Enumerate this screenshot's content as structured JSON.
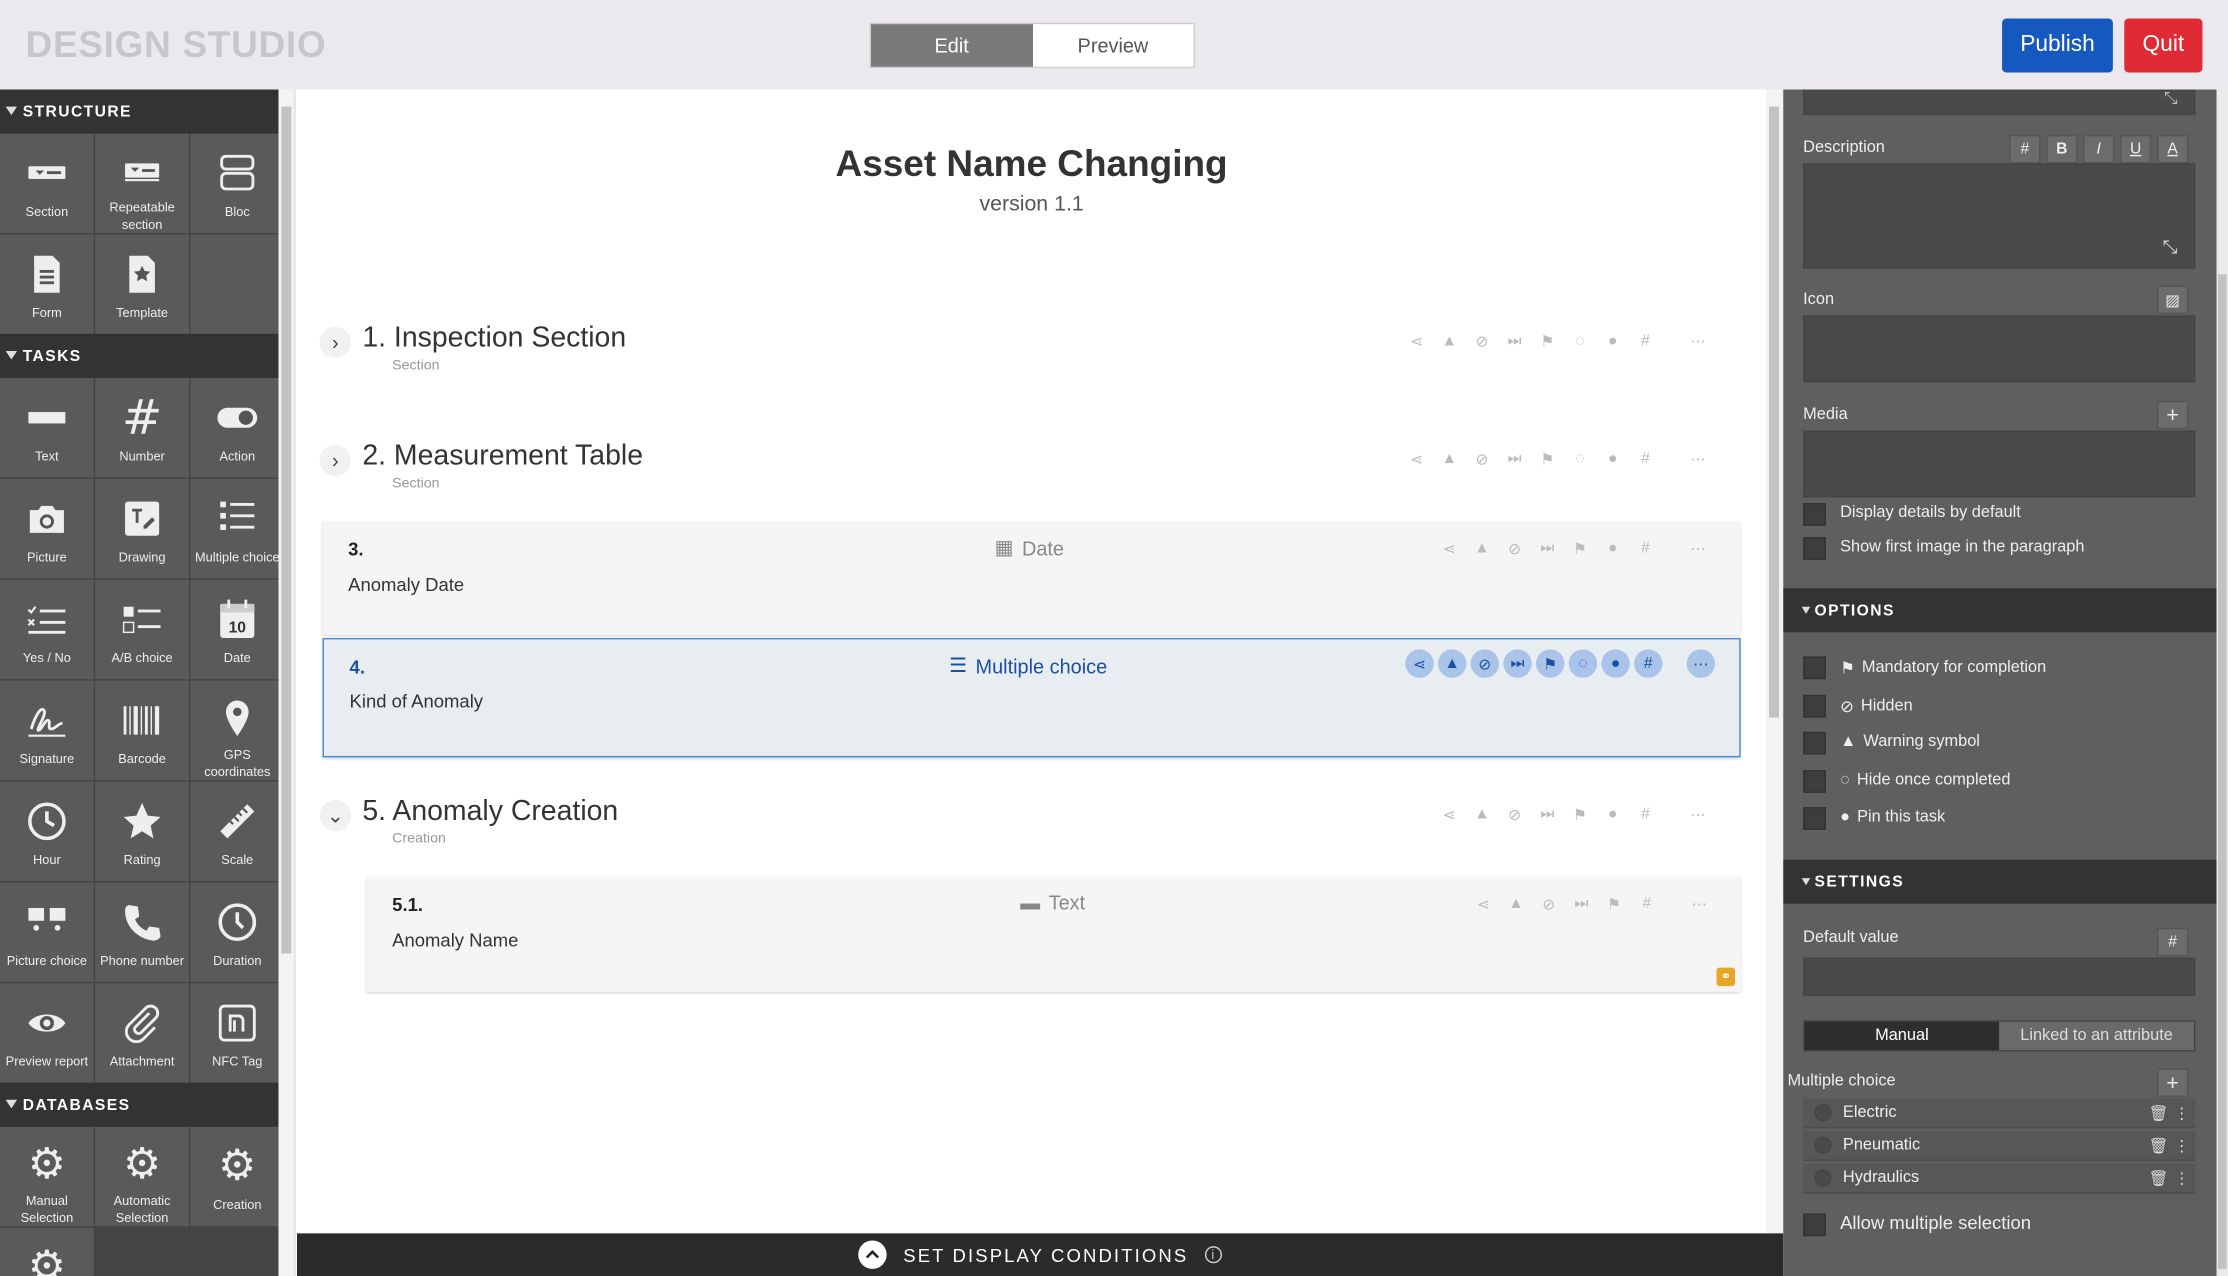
{
  "app": {
    "brand": "DESIGN STUDIO"
  },
  "mode_toggle": {
    "edit": "Edit",
    "preview": "Preview",
    "active": "Edit"
  },
  "actions": {
    "publish": "Publish",
    "quit": "Quit"
  },
  "colors": {
    "publish": "#1558c0",
    "quit": "#e02a35",
    "selected_accent": "#1d4fa3"
  },
  "palette": {
    "structure": {
      "title": "STRUCTURE",
      "items": [
        {
          "label": "Section",
          "icon": "section-icon"
        },
        {
          "label": "Repeatable section",
          "icon": "repeatable-section-icon"
        },
        {
          "label": "Bloc",
          "icon": "bloc-icon"
        },
        {
          "label": "Form",
          "icon": "form-icon"
        },
        {
          "label": "Template",
          "icon": "template-icon"
        }
      ]
    },
    "tasks": {
      "title": "TASKS",
      "items": [
        {
          "label": "Text",
          "icon": "text-field-icon"
        },
        {
          "label": "Number",
          "icon": "hash-icon"
        },
        {
          "label": "Action",
          "icon": "toggle-icon"
        },
        {
          "label": "Picture",
          "icon": "camera-icon"
        },
        {
          "label": "Drawing",
          "icon": "drawing-icon"
        },
        {
          "label": "Multiple choice",
          "icon": "list-icon"
        },
        {
          "label": "Yes / No",
          "icon": "yes-no-icon"
        },
        {
          "label": "A/B choice",
          "icon": "ab-choice-icon"
        },
        {
          "label": "Date",
          "icon": "calendar-icon"
        },
        {
          "label": "Signature",
          "icon": "signature-icon"
        },
        {
          "label": "Barcode",
          "icon": "barcode-icon"
        },
        {
          "label": "GPS coordinates",
          "icon": "location-pin-icon"
        },
        {
          "label": "Hour",
          "icon": "clock-icon"
        },
        {
          "label": "Rating",
          "icon": "star-icon"
        },
        {
          "label": "Scale",
          "icon": "ruler-icon"
        },
        {
          "label": "Picture choice",
          "icon": "picture-choice-icon"
        },
        {
          "label": "Phone number",
          "icon": "phone-icon"
        },
        {
          "label": "Duration",
          "icon": "duration-icon"
        },
        {
          "label": "Preview report",
          "icon": "eye-icon"
        },
        {
          "label": "Attachment",
          "icon": "paperclip-icon"
        },
        {
          "label": "NFC Tag",
          "icon": "nfc-icon"
        }
      ]
    },
    "databases": {
      "title": "DATABASES",
      "items": [
        {
          "label": "Manual Selection",
          "icon": "gear-icon"
        },
        {
          "label": "Automatic Selection",
          "icon": "gear-icon"
        },
        {
          "label": "Creation",
          "icon": "gear-icon"
        }
      ]
    }
  },
  "form": {
    "title": "Asset Name Changing",
    "version": "version 1.1",
    "sections": [
      {
        "label": "1. Inspection Section",
        "type": "Section"
      },
      {
        "label": "2. Measurement Table",
        "type": "Section"
      },
      {
        "label": "5. Anomaly Creation",
        "type": "Creation"
      }
    ],
    "tasks": [
      {
        "num": "3.",
        "type": "Date",
        "name": "Anomaly Date"
      },
      {
        "num": "4.",
        "type": "Multiple choice",
        "name": "Kind of Anomaly",
        "selected": true
      },
      {
        "num": "5.1.",
        "type": "Text",
        "name": "Anomaly Name"
      }
    ],
    "toolbar_icons": [
      "branch-icon",
      "warning-icon",
      "hidden-icon",
      "skip-icon",
      "flag-icon",
      "hide-completed-icon",
      "pin-icon",
      "hash-icon",
      "more-icon"
    ]
  },
  "bottom_bar": {
    "label": "SET DISPLAY CONDITIONS"
  },
  "properties": {
    "description_label": "Description",
    "format_buttons": [
      "#",
      "B",
      "I",
      "U",
      "A"
    ],
    "icon_label": "Icon",
    "media_label": "Media",
    "display_details": "Display details by default",
    "show_first_image": "Show first image in the paragraph",
    "options_title": "OPTIONS",
    "options": [
      "Mandatory for completion",
      "Hidden",
      "Warning symbol",
      "Hide once completed",
      "Pin this task"
    ],
    "settings_title": "SETTINGS",
    "default_value_label": "Default value",
    "mode_manual": "Manual",
    "mode_linked": "Linked to an attribute",
    "multiple_choice_label": "Multiple choice",
    "choices": [
      "Electric",
      "Pneumatic",
      "Hydraulics"
    ],
    "allow_multiple": "Allow multiple selection"
  }
}
